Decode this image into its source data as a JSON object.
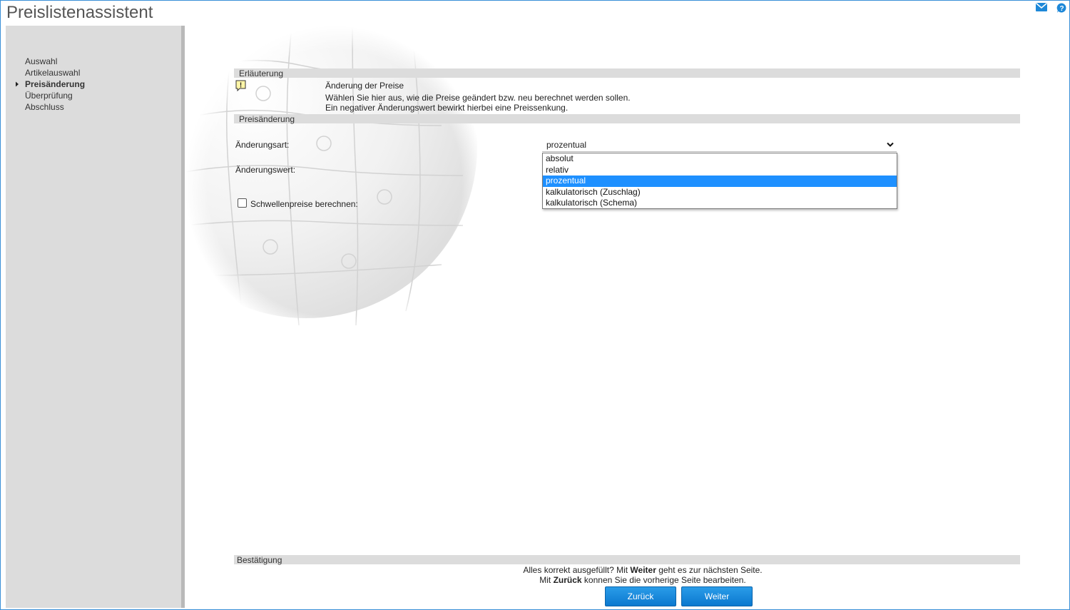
{
  "app": {
    "title": "Preislistenassistent"
  },
  "header_icons": [
    "mail-icon",
    "help-icon"
  ],
  "sidebar": {
    "items": [
      {
        "label": "Auswahl",
        "active": false
      },
      {
        "label": "Artikelauswahl",
        "active": false
      },
      {
        "label": "Preisänderung",
        "active": true
      },
      {
        "label": "Überprüfung",
        "active": false
      },
      {
        "label": "Abschluss",
        "active": false
      }
    ]
  },
  "explanation": {
    "section_label": "Erläuterung",
    "heading": "Änderung der Preise",
    "line1": "Wählen Sie hier aus, wie die Preise geändert bzw. neu berechnet werden sollen.",
    "line2": "Ein negativer Änderungswert bewirkt hierbei eine Preissenkung."
  },
  "price_change": {
    "section_label": "Preisänderung",
    "type_label": "Änderungsart:",
    "type_value": "prozentual",
    "type_options": [
      "absolut",
      "relativ",
      "prozentual",
      "kalkulatorisch (Zuschlag)",
      "kalkulatorisch (Schema)"
    ],
    "value_label": "Änderungswert:",
    "threshold_label": "Schwellenpreise berechnen:",
    "threshold_checked": false
  },
  "confirmation": {
    "section_label": "Bestätigung",
    "line1_pre": "Alles korrekt ausgefüllt?  Mit ",
    "line1_bold": "Weiter",
    "line1_post": " geht es zur nächsten Seite.",
    "line2_pre": "Mit ",
    "line2_bold": "Zurück",
    "line2_post": " konnen Sie die vorherige Seite bearbeiten.",
    "back_label": "Zurück",
    "next_label": "Weiter"
  },
  "colors": {
    "accent": "#1e90ff",
    "button": "#1a86dc",
    "sidebar": "#dcdcdc",
    "section_bar": "#dcdcdc"
  }
}
